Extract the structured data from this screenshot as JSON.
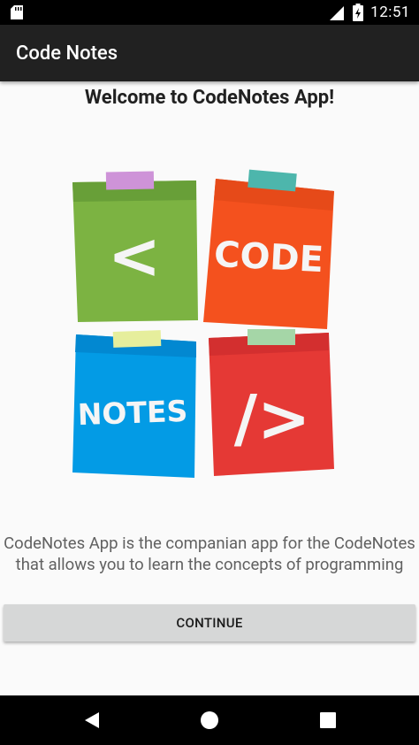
{
  "status_bar": {
    "time": "12:51",
    "network": "LTE",
    "icons": [
      "sd-card-icon",
      "lte-signal-icon",
      "battery-charging-icon"
    ]
  },
  "app_bar": {
    "title": "Code Notes"
  },
  "main": {
    "welcome": "Welcome to CodeNotes App!",
    "logo": {
      "notes": [
        {
          "label": "<",
          "color": "#7cb342",
          "tape": "#ce93d8"
        },
        {
          "label": "CODE",
          "color": "#f4511e",
          "tape": "#4db6ac"
        },
        {
          "label": "NOTES",
          "color": "#039be5",
          "tape": "#e6ee9c"
        },
        {
          "label": "/>",
          "color": "#e53935",
          "tape": "#a5d6a7"
        }
      ]
    },
    "description": "CodeNotes App is the companian app for the CodeNotes that allows you to learn the concepts of programming",
    "continue_label": "CONTINUE"
  },
  "nav_bar": {
    "icons": [
      "back-icon",
      "home-icon",
      "recents-icon"
    ]
  }
}
